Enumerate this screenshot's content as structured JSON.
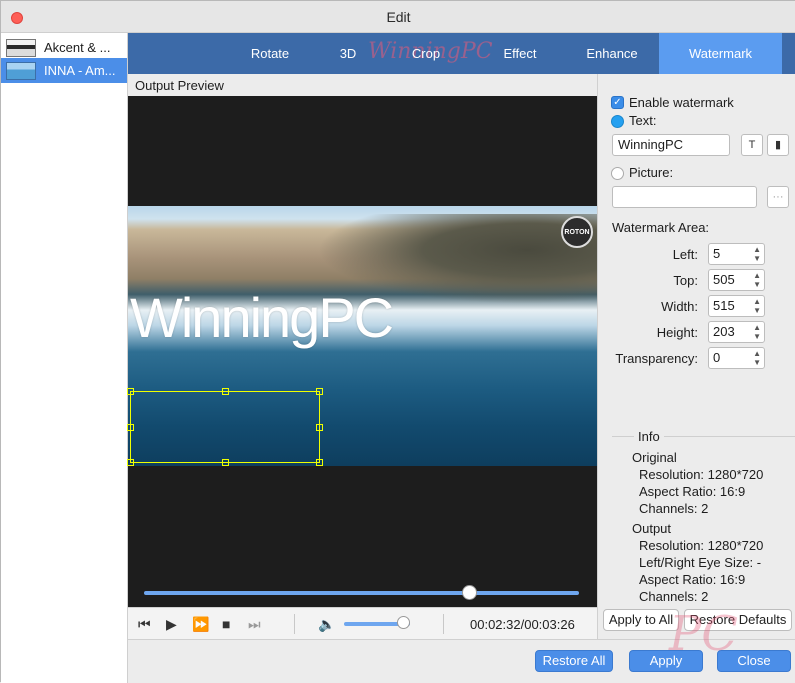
{
  "window": {
    "title": "Edit"
  },
  "files": [
    {
      "label": "Akcent & ..."
    },
    {
      "label": "INNA - Am..."
    }
  ],
  "tabs": [
    {
      "label": "Rotate"
    },
    {
      "label": "3D"
    },
    {
      "label": "Crop"
    },
    {
      "label": "Effect"
    },
    {
      "label": "Enhance"
    },
    {
      "label": "Watermark"
    }
  ],
  "overlay_logo": {
    "text": "WinningPC",
    "pc_mark": "PC"
  },
  "preview": {
    "label": "Output Preview",
    "watermark_text": "WinningPC",
    "badge": "ROTON",
    "progress_fraction": 0.746,
    "volume_fraction": 0.9,
    "timecode": "00:02:32/00:03:26"
  },
  "controls": {
    "prev": "⏮",
    "play": "▶",
    "forward": "⏩",
    "stop": "■",
    "next": "⏭",
    "volume": "🔈"
  },
  "watermark": {
    "enable_label": "Enable watermark",
    "enabled": true,
    "text_option_label": "Text:",
    "text_value": "WinningPC",
    "text_font_btn": "T",
    "text_color_btn": "▮",
    "picture_option_label": "Picture:",
    "picture_value": "",
    "browse_btn": "···",
    "area_label": "Watermark Area:",
    "fields": [
      {
        "label": "Left:",
        "value": "5"
      },
      {
        "label": "Top:",
        "value": "505"
      },
      {
        "label": "Width:",
        "value": "515"
      },
      {
        "label": "Height:",
        "value": "203"
      },
      {
        "label": "Transparency:",
        "value": "0"
      }
    ]
  },
  "info": {
    "title": "Info",
    "original_label": "Original",
    "original": [
      "Resolution: 1280*720",
      "Aspect Ratio: 16:9",
      "Channels: 2"
    ],
    "output_label": "Output",
    "output": [
      "Resolution: 1280*720",
      "Left/Right Eye Size: -",
      "Aspect Ratio: 16:9",
      "Channels: 2"
    ]
  },
  "buttons": {
    "apply_all": "Apply to All",
    "restore_defaults": "Restore Defaults",
    "restore_all": "Restore All",
    "apply": "Apply",
    "close": "Close"
  },
  "colors": {
    "tabbar": "#3c6aa8",
    "active_tab": "#5b9cf0",
    "accent": "#4b8ee8"
  }
}
